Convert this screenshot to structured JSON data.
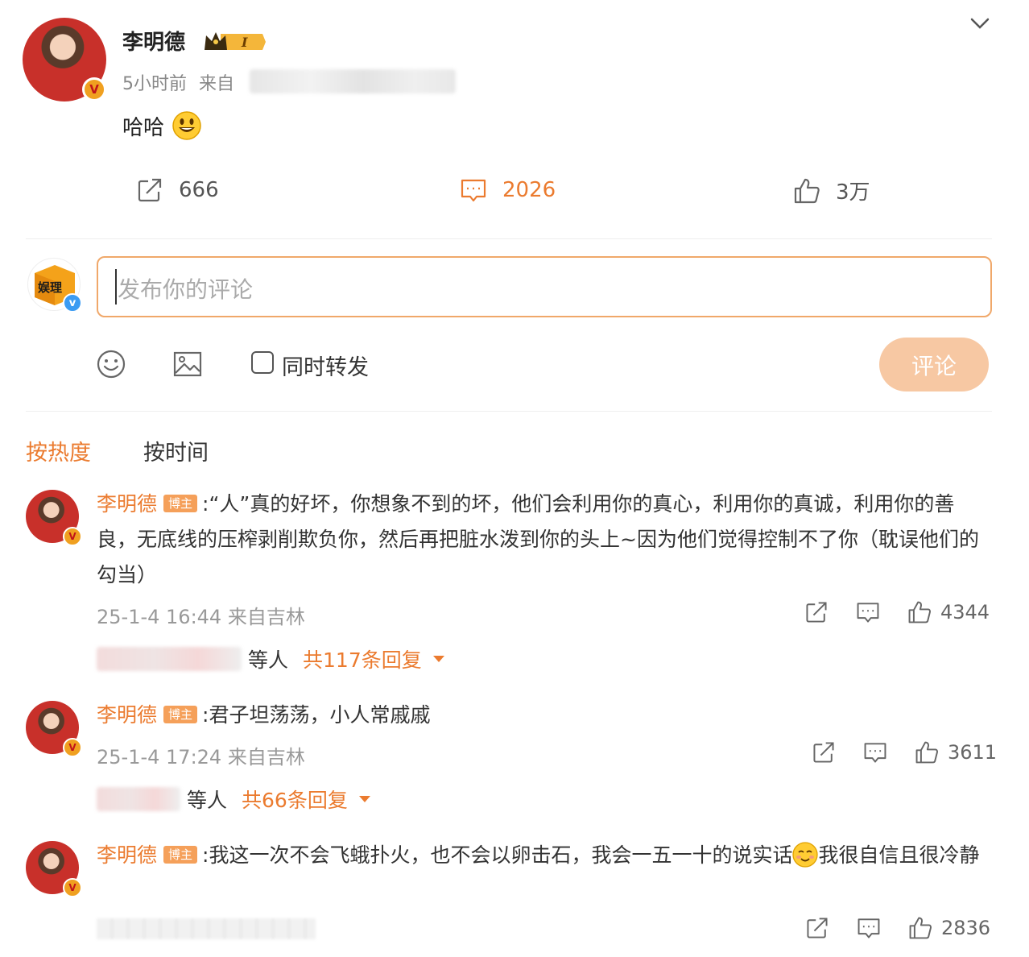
{
  "post": {
    "author": "李明德",
    "time": "5小时前",
    "source_prefix": "来自",
    "text": "哈哈",
    "emoji": "smiley-face-icon",
    "reposts": "666",
    "comments": "2026",
    "likes": "3万"
  },
  "composer": {
    "placeholder": "发布你的评论",
    "repost_label": "同时转发",
    "submit_label": "评论",
    "my_avatar_text": "娱理"
  },
  "sort_tabs": {
    "hot": "按热度",
    "time": "按时间"
  },
  "comments": [
    {
      "name": "李明德",
      "tag": "博主",
      "text": ":“人”真的好坏，你想象不到的坏，他们会利用你的真心，利用你的真诚，利用你的善良，无底线的压榨剥削欺负你，然后再把脏水泼到你的头上~因为他们觉得控制不了你（耽误他们的勾当）",
      "meta": "25-1-4 16:44 来自吉林",
      "likes": "4344",
      "reply_suffix": "等人",
      "reply_count": "共117条回复"
    },
    {
      "name": "李明德",
      "tag": "博主",
      "text": ":君子坦荡荡，小人常戚戚",
      "meta": "25-1-4 17:24 来自吉林",
      "likes": "3611",
      "reply_suffix": "等人",
      "reply_count": "共66条回复"
    },
    {
      "name": "李明德",
      "tag": "博主",
      "text_before_emoji": ":我这一次不会飞蛾扑火，也不会以卵击石，我会一五一十的说实话",
      "text_after_emoji": "我很自信且很冷静",
      "likes": "2836"
    }
  ],
  "colors": {
    "accent": "#eb7b2f",
    "submit_disabled": "#f7c8a3",
    "input_border": "#f0a86a",
    "text_muted": "#999999"
  }
}
